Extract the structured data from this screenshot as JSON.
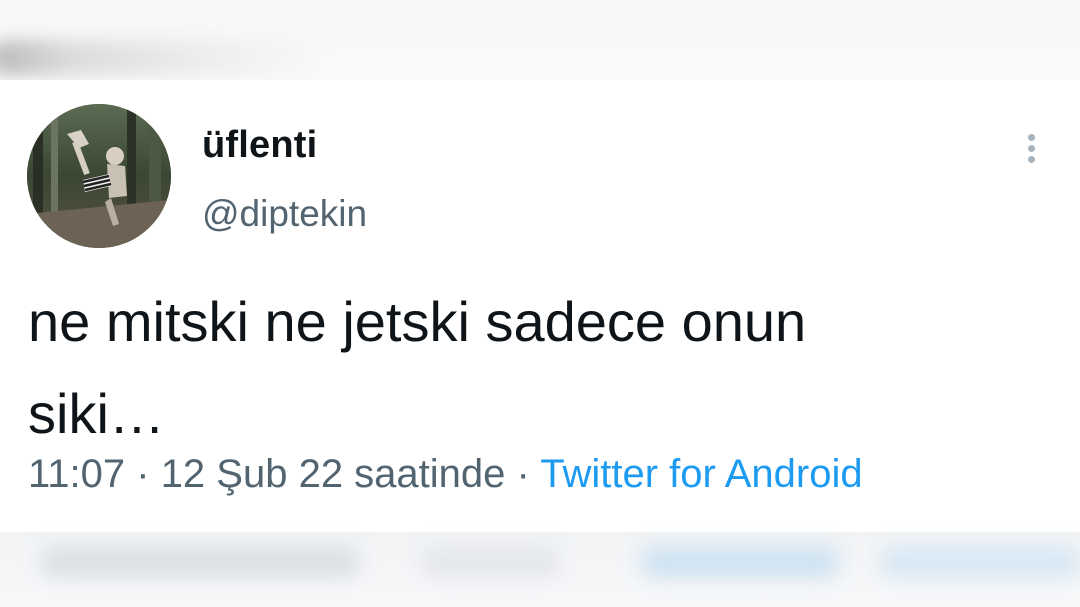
{
  "tweet": {
    "display_name": "üflenti",
    "handle": "@diptekin",
    "text_line1": "ne mitski ne jetski sadece onun",
    "text_line2": "siki…",
    "time": "11:07",
    "separator1": " · ",
    "date": "12 Şub 22 saatinde",
    "separator2": " · ",
    "source": "Twitter for Android",
    "avatar_icon": "profile-photo",
    "more_icon": "more-vertical-icon"
  },
  "colors": {
    "text_primary": "#0f1419",
    "text_secondary": "#536471",
    "link": "#1d9bf0",
    "more_icon": "#a8b4bd"
  }
}
